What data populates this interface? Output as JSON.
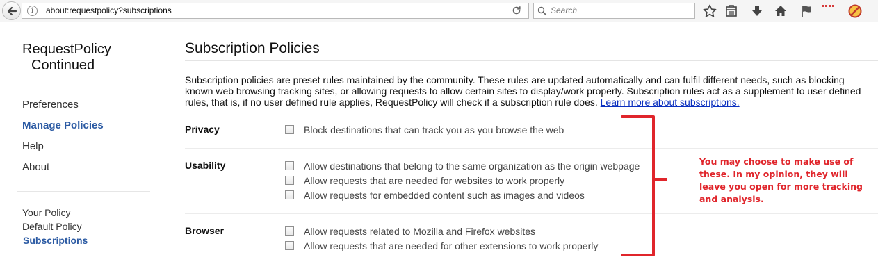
{
  "browser": {
    "url": "about:requestpolicy?subscriptions",
    "search_placeholder": "Search"
  },
  "sidebar": {
    "brand_line1": "RequestPolicy",
    "brand_line2": "Continued",
    "nav": [
      {
        "label": "Preferences",
        "active": false
      },
      {
        "label": "Manage Policies",
        "active": true
      },
      {
        "label": "Help",
        "active": false
      },
      {
        "label": "About",
        "active": false
      }
    ],
    "policy_nav": [
      {
        "label": "Your Policy",
        "active": false
      },
      {
        "label": "Default Policy",
        "active": false
      },
      {
        "label": "Subscriptions",
        "active": true
      }
    ]
  },
  "main": {
    "title": "Subscription Policies",
    "intro": "Subscription policies are preset rules maintained by the community. These rules are updated automatically and can fulfil different needs, such as blocking known web browsing tracking sites, or allowing requests to allow certain sites to display/work properly. Subscription rules act as a supplement to user defined rules, that is, if no user defined rule applies, RequestPolicy will check if a subscription rule does.",
    "learn_more": "Learn more about subscriptions.",
    "sections": [
      {
        "label": "Privacy",
        "options": [
          "Block destinations that can track you as you browse the web"
        ]
      },
      {
        "label": "Usability",
        "options": [
          "Allow destinations that belong to the same organization as the origin webpage",
          "Allow requests that are needed for websites to work properly",
          "Allow requests for embedded content such as images and videos"
        ]
      },
      {
        "label": "Browser",
        "options": [
          "Allow requests related to Mozilla and Firefox websites",
          "Allow requests that are needed for other extensions to work properly"
        ]
      }
    ]
  },
  "annotation": {
    "text": "You may choose to make use of these. In my opinion, they will leave you open for more tracking and analysis.",
    "color": "#e0252b"
  },
  "colors": {
    "accent": "#2b5aa3",
    "link": "#0a2fbf"
  }
}
